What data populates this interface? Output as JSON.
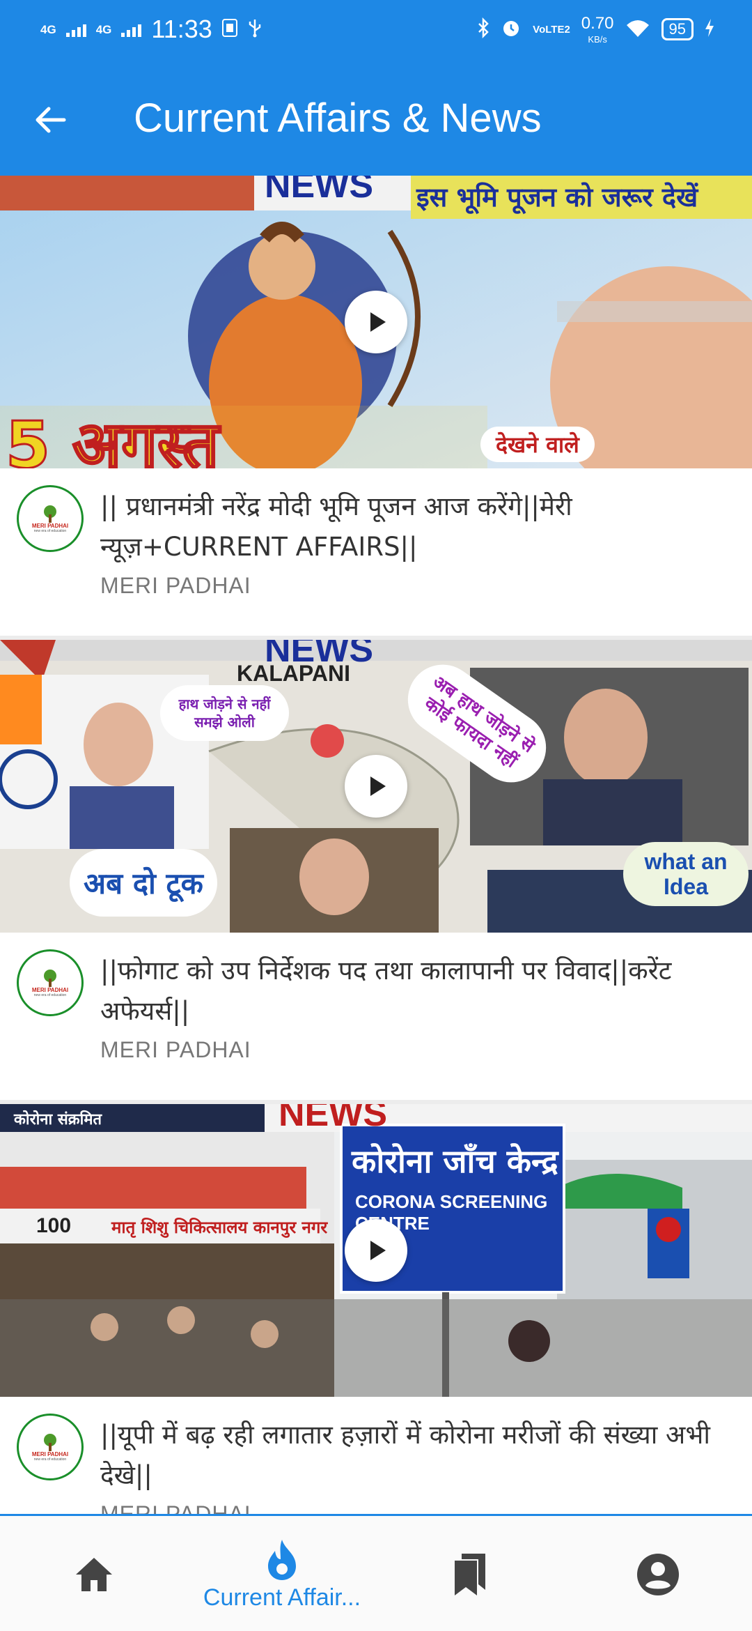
{
  "status_bar": {
    "time": "11:33",
    "network_1": "4G",
    "network_2": "4G",
    "lte_label": "VoLTE2",
    "speed_value": "0.70",
    "speed_unit": "KB/s",
    "battery": "95"
  },
  "app_bar": {
    "title": "Current Affairs & News",
    "back_icon": "arrow-left-icon"
  },
  "videos": [
    {
      "thumb_top_text": "NEWS",
      "thumb_banner": "इस भूमि पूजन को जरूर देखें",
      "thumb_big_text": "5 अगस्त",
      "thumb_tag": "देखने वाले",
      "title": "|| प्रधानमंत्री नरेंद्र मोदी भूमि पूजन आज करेंगे||मेरी न्यूज़+CURRENT AFFAIRS||",
      "channel": "MERI PADHAI"
    },
    {
      "thumb_top_text": "NEWS",
      "thumb_map_label": "KALAPANI",
      "thumb_bubble_1": "हाथ जोड़ने से नहीं समझे ओली",
      "thumb_bubble_2": "अब हाथ जोड़ने से कोई फायदा नहीं",
      "thumb_bubble_3": "अब दो टूक",
      "thumb_bubble_4": "what an Idea",
      "title": "||फोगाट  को उप निर्देशक पद तथा कालापानी पर विवाद||करेंट अफेयर्स||",
      "channel": "MERI PADHAI"
    },
    {
      "thumb_top_text": "NEWS",
      "thumb_left_label": "कोरोना संक्रमित",
      "thumb_sign_1": "कोरोना जाँच केन्द्र",
      "thumb_sign_2": "CORONA SCREENING CENTRE",
      "thumb_building": "मातृ शिशु चिकित्सालय कानपुर नगर",
      "thumb_building_num": "100",
      "title": "||यूपी में बढ़ रही लगातार हज़ारों में कोरोना मरीजों की संख्या अभी देखे||",
      "channel": "MERI PADHAI"
    }
  ],
  "avatar": {
    "brand": "MERI PADHAI",
    "tagline": "new era of education"
  },
  "bottom_nav": {
    "items": [
      {
        "icon": "home-icon",
        "label": ""
      },
      {
        "icon": "flame-icon",
        "label": "Current Affair..."
      },
      {
        "icon": "bookmarks-icon",
        "label": ""
      },
      {
        "icon": "account-icon",
        "label": ""
      }
    ],
    "active_index": 1
  },
  "colors": {
    "primary": "#1e88e5",
    "text_title": "#333333",
    "text_channel": "#777777",
    "avatar_border": "#1a8f2a"
  }
}
